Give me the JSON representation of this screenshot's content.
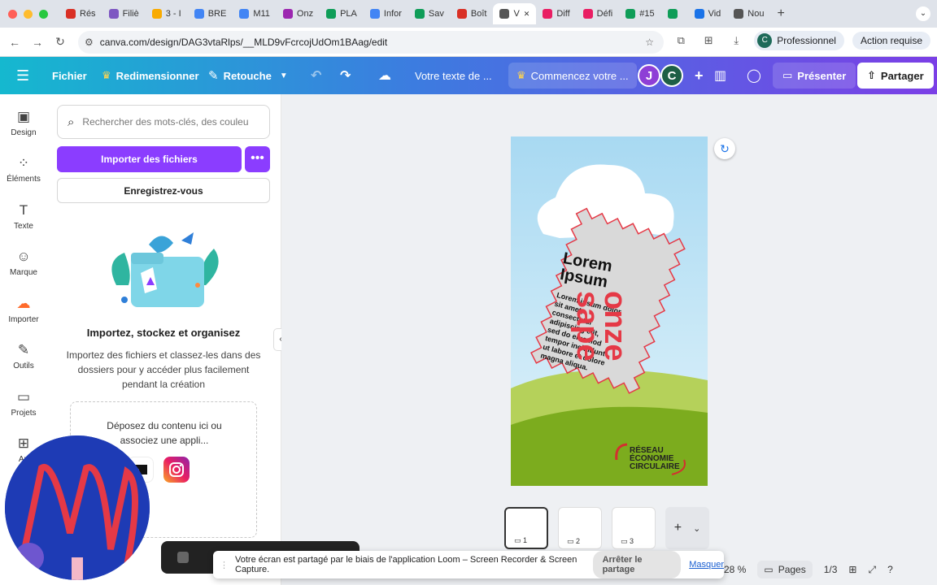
{
  "browser": {
    "tabs": [
      {
        "label": "Rés",
        "color": "#d93025"
      },
      {
        "label": "Filiè",
        "color": "#7e57c2"
      },
      {
        "label": "3 - I",
        "color": "#f9ab00"
      },
      {
        "label": "BRE",
        "color": "#4285f4"
      },
      {
        "label": "M11",
        "color": "#4285f4"
      },
      {
        "label": "Onz",
        "color": "#9c27b0"
      },
      {
        "label": "PLA",
        "color": "#0f9d58"
      },
      {
        "label": "Infor",
        "color": "#4285f4"
      },
      {
        "label": "Sav",
        "color": "#0f9d58"
      },
      {
        "label": "Boît",
        "color": "#d93025"
      },
      {
        "label": "V",
        "color": "#555555",
        "active": true
      },
      {
        "label": "Diff",
        "color": "#e91e63"
      },
      {
        "label": "Défi",
        "color": "#e91e63"
      },
      {
        "label": "#15",
        "color": "#0f9d58"
      },
      {
        "label": "",
        "color": "#0f9d58"
      },
      {
        "label": "Vid",
        "color": "#1a73e8"
      },
      {
        "label": "Nou",
        "color": "#555555"
      }
    ],
    "url": "canva.com/design/DAG3vtaRlps/__MLD9vFcrcojUdOm1BAag/edit",
    "profile_initial": "C",
    "profile_label": "Professionnel",
    "action_label": "Action requise"
  },
  "toolbar": {
    "file": "Fichier",
    "resize": "Redimensionner",
    "retouch": "Retouche",
    "text_field": "Votre texte de ...",
    "start": "Commencez votre ...",
    "avatar1": "J",
    "avatar2": "C",
    "present": "Présenter",
    "share": "Partager",
    "colors": {
      "accent": "#8b3dff",
      "avatar1": "#8e3fd6",
      "avatar2": "#1e5f46"
    }
  },
  "sidebar": {
    "items": [
      {
        "label": "Design",
        "icon": "design-icon"
      },
      {
        "label": "Éléments",
        "icon": "elements-icon"
      },
      {
        "label": "Texte",
        "icon": "text-icon"
      },
      {
        "label": "Marque",
        "icon": "brand-icon"
      },
      {
        "label": "Importer",
        "icon": "upload-icon"
      },
      {
        "label": "Outils",
        "icon": "tools-icon"
      },
      {
        "label": "Projets",
        "icon": "folder-icon"
      },
      {
        "label": "Ap",
        "icon": "apps-icon"
      }
    ]
  },
  "panel": {
    "search_placeholder": "Rechercher des mots-clés, des couleu",
    "import_button": "Importer des fichiers",
    "register_button": "Enregistrez-vous",
    "title": "Importez, stockez et organisez",
    "description": "Importez des fichiers et classez-les dans des dossiers pour y accéder plus facilement pendant la création",
    "drop_line1": "Déposez du contenu ici ou",
    "drop_line2": "associez une appli..."
  },
  "design": {
    "heading_line1": "Lorem",
    "heading_line2": "Ipsum",
    "body_lines": [
      "Lorem ipsum dolor",
      "sit amet,",
      "consectetur",
      "adipiscing elit,",
      "sed do eiusmod",
      "tempor incididunt",
      "ut labore et dolore",
      "magna aliqua."
    ],
    "brand_line1": "onze",
    "brand_line2": "sape",
    "logo_line1": "RÉSEAU",
    "logo_line2": "ÉCONOMIE",
    "logo_line3": "CIRCULAIRE"
  },
  "pages": {
    "thumbs": [
      "1",
      "2",
      "3"
    ],
    "zoom": "28 %",
    "pages_label": "Pages",
    "page_indicator": "1/3"
  },
  "loom": {
    "message": "Votre écran est partagé par le biais de l'application Loom – Screen Recorder & Screen Capture.",
    "stop": "Arrêter le partage",
    "hide": "Masquer"
  }
}
